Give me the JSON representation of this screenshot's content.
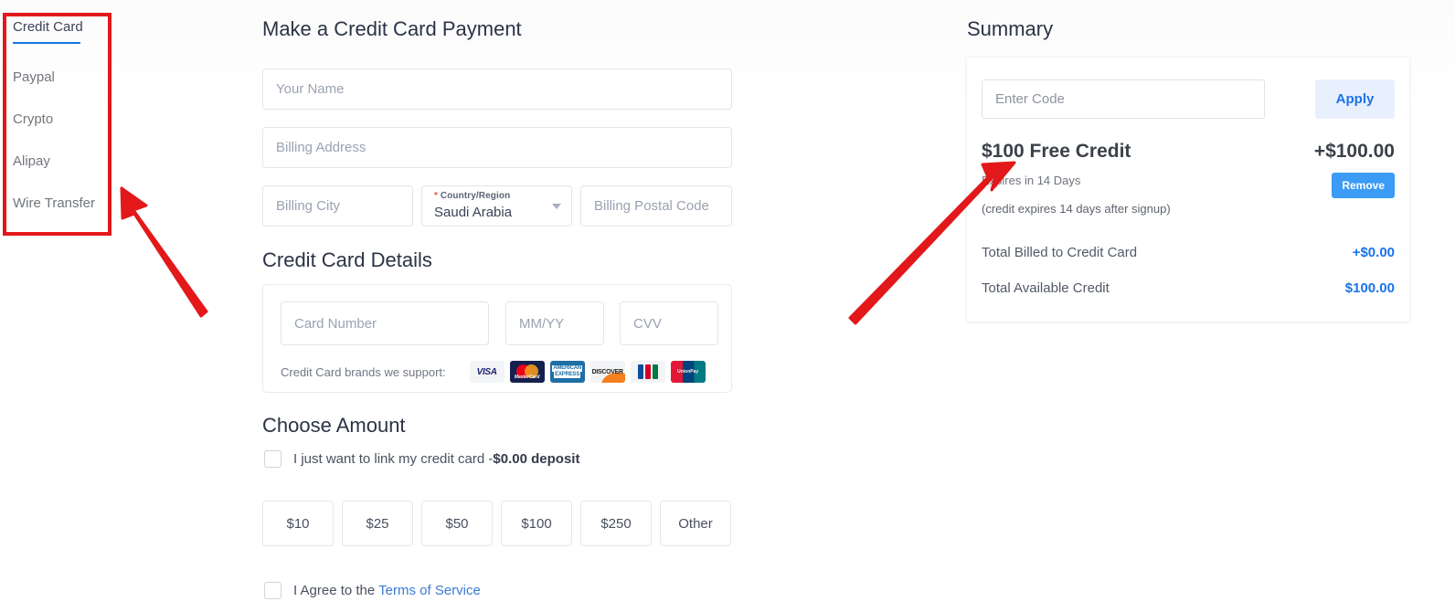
{
  "sidebar": {
    "items": [
      {
        "label": "Credit Card",
        "active": true
      },
      {
        "label": "Paypal",
        "active": false
      },
      {
        "label": "Crypto",
        "active": false
      },
      {
        "label": "Alipay",
        "active": false
      },
      {
        "label": "Wire Transfer",
        "active": false
      }
    ],
    "active_accent": "#1675e0"
  },
  "main": {
    "page_title": "Make a Credit Card Payment",
    "fields": {
      "name_placeholder": "Your Name",
      "address_placeholder": "Billing Address",
      "city_placeholder": "Billing City",
      "postal_placeholder": "Billing Postal Code",
      "country_required_mark": "*",
      "country_label": "Country/Region",
      "country_value": "Saudi Arabia"
    },
    "card_section": {
      "title": "Credit Card Details",
      "number_placeholder": "Card Number",
      "expiry_placeholder": "MM/YY",
      "cvv_placeholder": "CVV",
      "brands_label": "Credit Card brands we support:",
      "brands": [
        {
          "name": "visa",
          "text": "VISA"
        },
        {
          "name": "mastercard",
          "text": "MasterCard"
        },
        {
          "name": "american-express",
          "text_1": "AMERICAN",
          "text_2": "EXPRESS"
        },
        {
          "name": "discover",
          "text": "DISCOVER"
        },
        {
          "name": "jcb",
          "text": "JCB"
        },
        {
          "name": "unionpay",
          "text_1": "UnionPay",
          "text_2": "银联"
        }
      ]
    },
    "amount_section": {
      "title": "Choose Amount",
      "link_card_text": "I just want to link my credit card -",
      "link_card_deposit": "$0.00 deposit",
      "amounts": [
        "$10",
        "$25",
        "$50",
        "$100",
        "$250",
        "Other"
      ],
      "agree_text": "I Agree to the ",
      "terms_link": "Terms of Service"
    }
  },
  "summary": {
    "title": "Summary",
    "code_placeholder": "Enter Code",
    "apply_label": "Apply",
    "credit_name": "$100 Free Credit",
    "credit_amount": "+$100.00",
    "credit_expiry": "Expires in 14 Days",
    "remove_label": "Remove",
    "credit_note": "(credit expires 14 days after signup)",
    "rows": [
      {
        "label": "Total Billed to Credit Card",
        "value": "+$0.00"
      },
      {
        "label": "Total Available Credit",
        "value": "$100.00"
      }
    ],
    "accent_color": "#1a73e8",
    "remove_color": "#3b9bf5"
  },
  "annotations": {
    "highlight_color": "#e2181b",
    "box_target": "payment-method-sidebar",
    "arrow_1_target": "payment-method-sidebar",
    "arrow_2_target": "free-credit-row"
  }
}
